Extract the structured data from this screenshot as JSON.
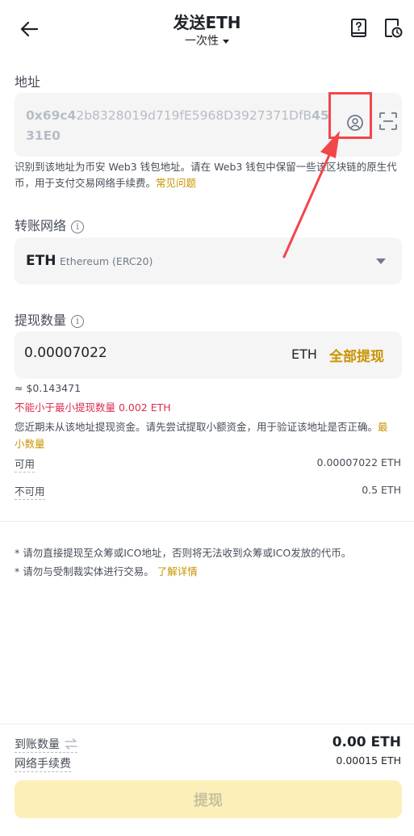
{
  "header": {
    "title": "发送ETH",
    "subtitle": "一次性"
  },
  "address": {
    "label": "地址",
    "value_prefix": "0x69c4",
    "value_middle": "2b8328019d719fE5968D3927371DfB",
    "value_suffix": "4531E0",
    "note": "识别到该地址为币安 Web3 钱包地址。请在 Web3 钱包中保留一些该区块链的原生代币，用于支付交易网络手续费。",
    "faq_link": "常见问题"
  },
  "network": {
    "label": "转账网络",
    "symbol": "ETH",
    "name": "Ethereum (ERC20)"
  },
  "amount": {
    "label": "提现数量",
    "value": "0.00007022",
    "unit": "ETH",
    "max_label": "全部提现",
    "approx": "≈ $0.143471",
    "error": "不能小于最小提现数量 0.002 ETH",
    "warning": "您近期未从该地址提现资金。请先尝试提取小额资金，用于验证该地址是否正确。",
    "min_link": "最小数量"
  },
  "balances": {
    "available_label": "可用",
    "available_value": "0.00007022 ETH",
    "unavailable_label": "不可用",
    "unavailable_value": "0.5 ETH"
  },
  "disclaimers": {
    "line1": "* 请勿直接提现至众筹或ICO地址，否则将无法收到众筹或ICO发放的代币。",
    "line2": "* 请勿与受制裁实体进行交易。",
    "learn_more": "了解详情"
  },
  "footer": {
    "received_label": "到账数量",
    "received_value": "0.00 ETH",
    "fee_label": "网络手续费",
    "fee_value": "0.00015 ETH",
    "submit_label": "提现"
  },
  "colors": {
    "accent": "#c99400",
    "error": "#d9304e",
    "highlight": "#f2464b",
    "button_disabled": "#fcefb8"
  },
  "icons": {
    "back": "arrow-left-icon",
    "guide": "book-question-icon",
    "history": "document-clock-icon",
    "contact": "user-circle-icon",
    "scan": "scan-icon",
    "info": "info-icon",
    "swap": "swap-arrows-icon"
  }
}
